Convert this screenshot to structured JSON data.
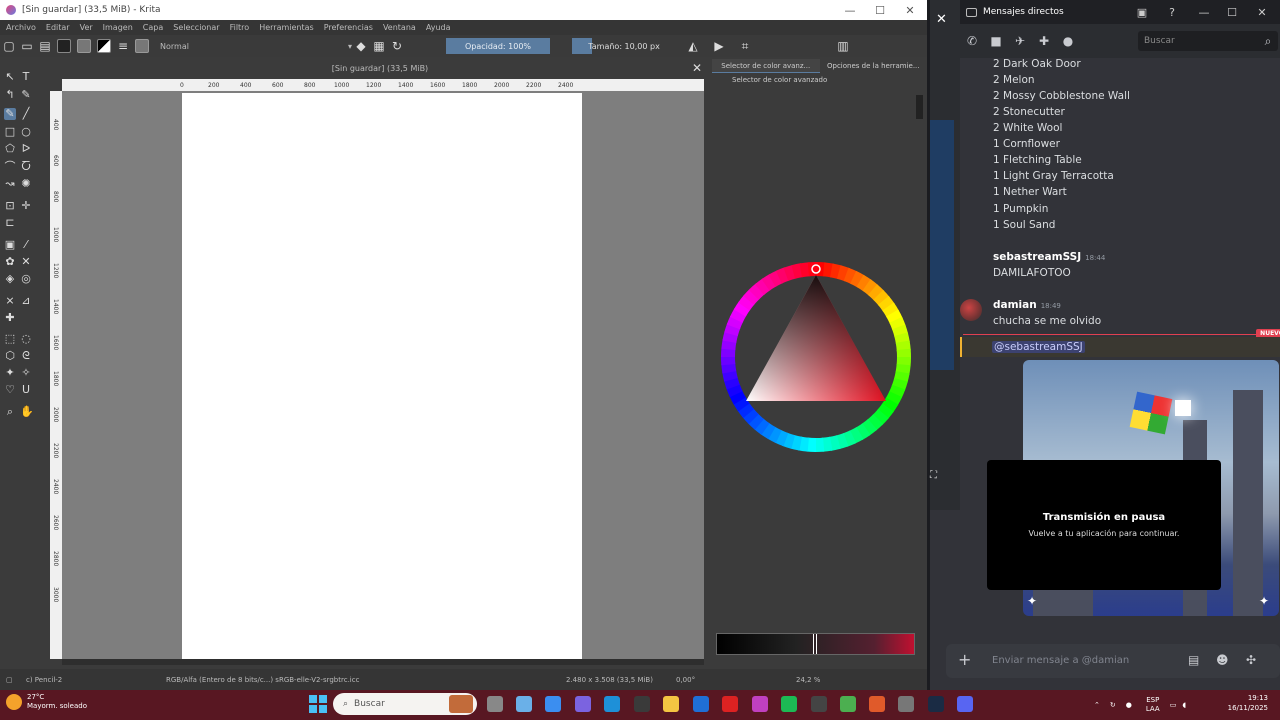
{
  "krita": {
    "window_title": "[Sin guardar]  (33,5 MiB)  - Krita",
    "menu": [
      "Archivo",
      "Editar",
      "Ver",
      "Imagen",
      "Capa",
      "Seleccionar",
      "Filtro",
      "Herramientas",
      "Preferencias",
      "Ventana",
      "Ayuda"
    ],
    "blend_mode": "Normal",
    "opacity": "Opacidad: 100%",
    "size": "Tamaño: 10,00 px",
    "canvas_tab": "[Sin guardar]  (33,5 MiB)",
    "ruler_ticks": [
      "0",
      "200",
      "400",
      "600",
      "800",
      "1000",
      "1200",
      "1400",
      "1600",
      "1800",
      "2000",
      "2200",
      "2400"
    ],
    "ruler_left_ticks": [
      "400",
      "600",
      "800",
      "1000",
      "1200",
      "1400",
      "1600",
      "1800",
      "2000",
      "2200",
      "2400",
      "2600",
      "2800",
      "3000"
    ],
    "docker_tabs": [
      "Selector de color avanz...",
      "Opciones de la herramie..."
    ],
    "docker_subtitle": "Selector de color avanzado",
    "status": {
      "tool": "c) Pencil-2",
      "color_info": "RGB/Alfa (Entero de 8 bits/c...)  sRGB-elle-V2-srgbtrc.icc",
      "dimensions": "2.480 x 3.508 (33,5 MiB)",
      "rotation": "0,00°",
      "zoom": "24,2 %"
    },
    "colors": {
      "accent": "#5a7ca0",
      "wheel_hue": "#e01020"
    }
  },
  "discord": {
    "title": "Mensajes directos",
    "search_placeholder": "Buscar",
    "items": [
      "2 Dark Oak Door",
      "2 Melon",
      "2 Mossy Cobblestone Wall",
      "2 Stonecutter",
      "2 White Wool",
      "1 Cornflower",
      "1 Fletching Table",
      "1 Light Gray Terracotta",
      "1 Nether Wart",
      "1 Pumpkin",
      "1 Soul Sand"
    ],
    "messages": [
      {
        "user": "sebastreamSSJ",
        "time": "18:44",
        "text": "DAMILAFOTOO"
      },
      {
        "user": "damian",
        "time": "18:49",
        "text": "chucha se me olvido"
      }
    ],
    "new_badge": "NUEVO",
    "mention": "@sebastreamSSJ",
    "pause_title": "Transmisión en pausa",
    "pause_subtitle": "Vuelve a tu aplicación para continuar.",
    "input_placeholder": "Enviar mensaje a @damian",
    "colors": {
      "new": "#e04050",
      "mention_bg": "#3c4270"
    }
  },
  "taskbar": {
    "weather_temp": "27°C",
    "weather_desc": "Mayorm. soleado",
    "search_placeholder": "Buscar",
    "lang_top": "ESP",
    "lang_bottom": "LAA",
    "time": "19:13",
    "date": "16/11/2025"
  }
}
